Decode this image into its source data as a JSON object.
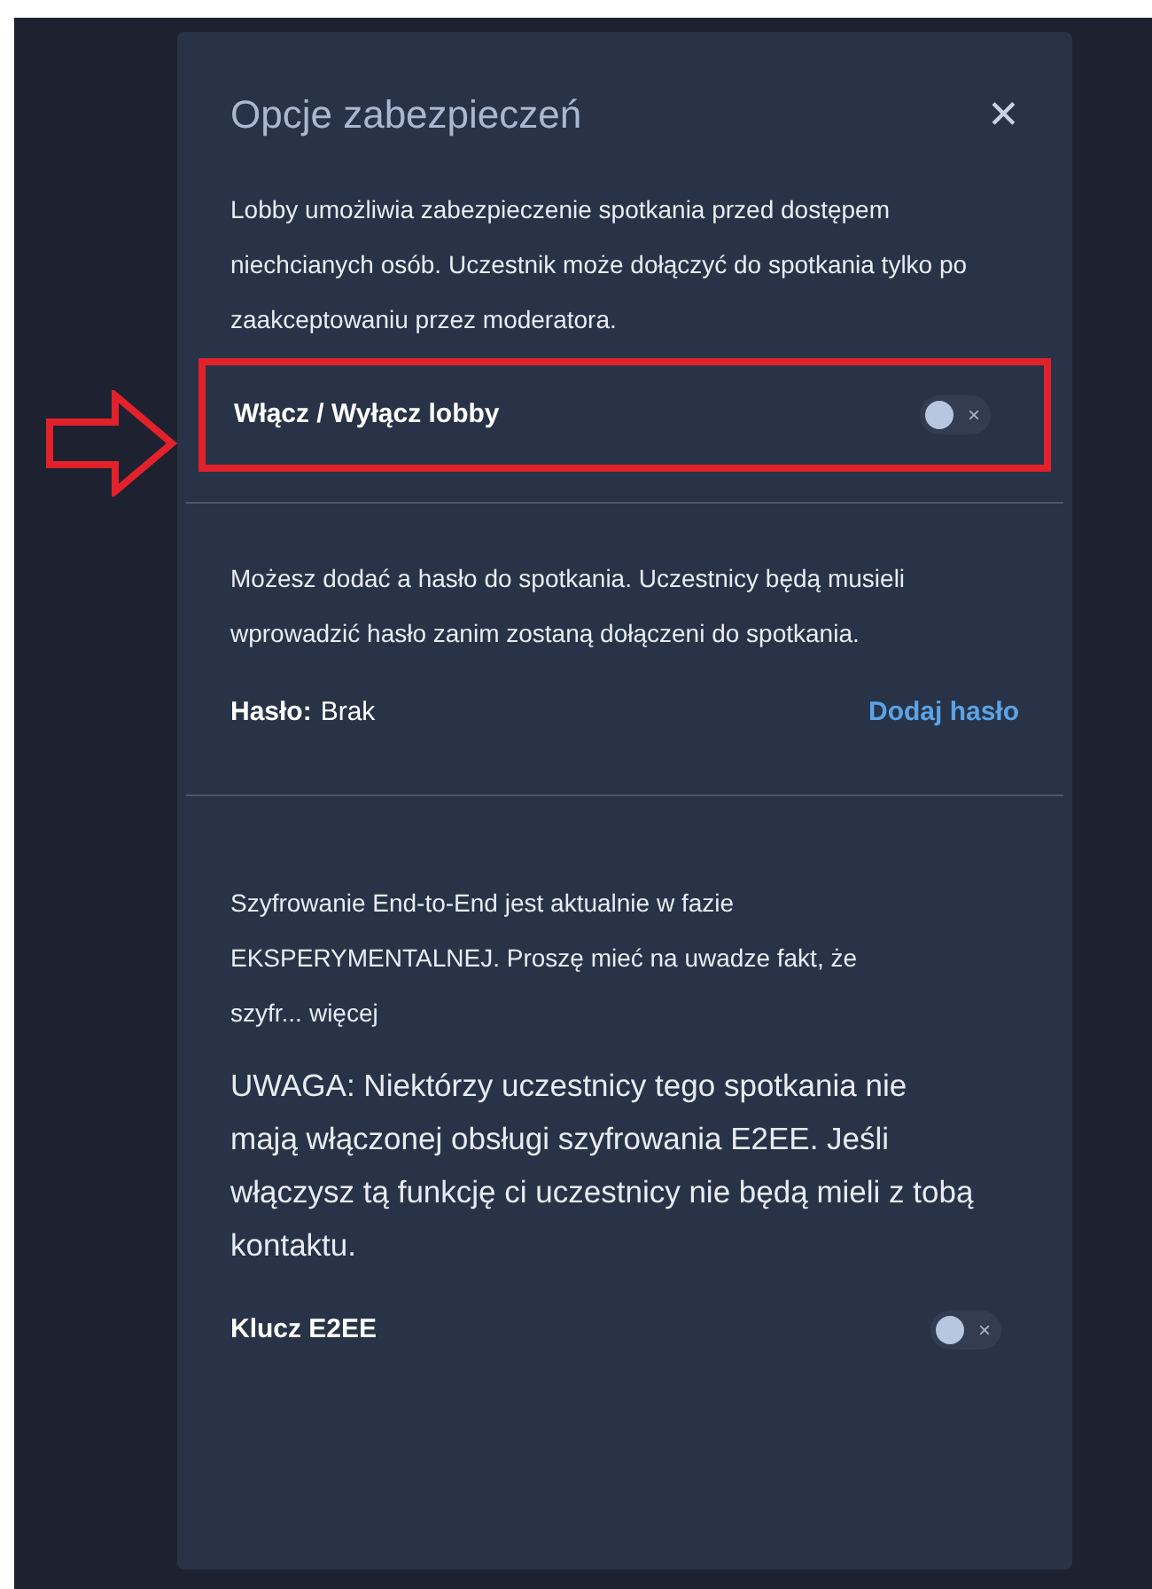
{
  "dialog": {
    "title": "Opcje zabezpieczeń",
    "close": "✕"
  },
  "lobby": {
    "description": "Lobby umożliwia zabezpieczenie spotkania przed dostępem niechcianych osób. Uczestnik może dołączyć do spotkania tylko po zaakceptowaniu przez moderatora.",
    "label": "Włącz / Wyłącz lobby",
    "on": false,
    "toggle_glyph": "×",
    "highlighted": true
  },
  "password": {
    "description": "Możesz dodać a hasło do spotkania. Uczestnicy będą musieli wprowadzić hasło zanim zostaną dołączeni do spotkania.",
    "label": "Hasło:",
    "value": "Brak",
    "action": "Dodaj hasło"
  },
  "e2ee": {
    "description": "Szyfrowanie End-to-End jest aktualnie w fazie EKSPERYMENTALNEJ. Proszę mieć na uwadze fakt, że",
    "description_cut": "szyfr...",
    "more": "więcej",
    "warning": "UWAGA: Niektórzy uczestnicy tego spotkania nie mają włączonej obsługi szyfrowania E2EE. Jeśli włączysz tą funkcję ci uczestnicy nie będą mieli z tobą kontaktu.",
    "label": "Klucz E2EE",
    "on": false,
    "toggle_glyph": "×"
  }
}
